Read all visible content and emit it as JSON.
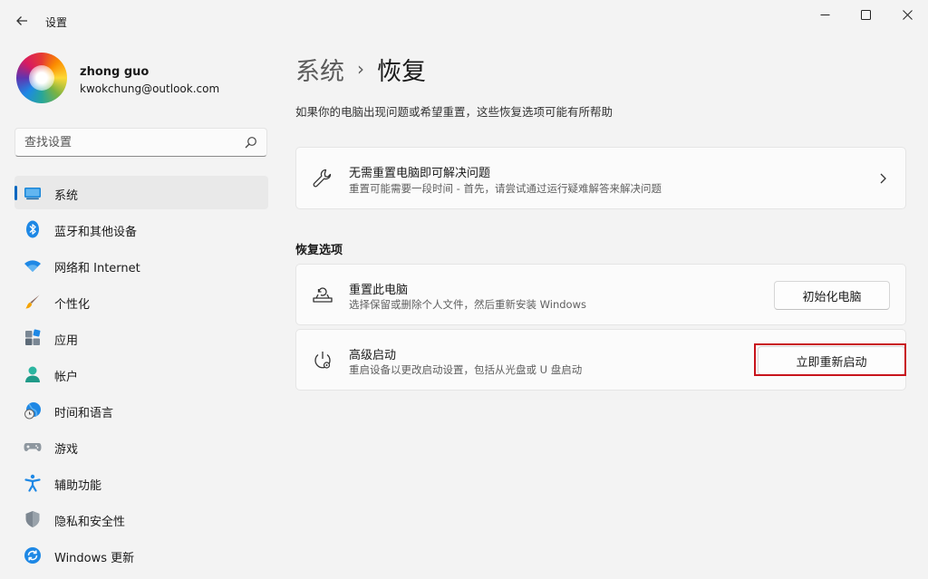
{
  "window": {
    "app_title": "设置"
  },
  "profile": {
    "name": "zhong guo",
    "email": "kwokchung@outlook.com"
  },
  "search": {
    "placeholder": "查找设置"
  },
  "sidebar": {
    "items": [
      {
        "label": "系统",
        "icon": "system-icon",
        "active": true
      },
      {
        "label": "蓝牙和其他设备",
        "icon": "bluetooth-icon"
      },
      {
        "label": "网络和 Internet",
        "icon": "wifi-icon"
      },
      {
        "label": "个性化",
        "icon": "brush-icon"
      },
      {
        "label": "应用",
        "icon": "apps-icon"
      },
      {
        "label": "帐户",
        "icon": "account-icon"
      },
      {
        "label": "时间和语言",
        "icon": "globe-clock-icon"
      },
      {
        "label": "游戏",
        "icon": "gamepad-icon"
      },
      {
        "label": "辅助功能",
        "icon": "accessibility-icon"
      },
      {
        "label": "隐私和安全性",
        "icon": "shield-icon"
      },
      {
        "label": "Windows 更新",
        "icon": "update-icon"
      }
    ]
  },
  "main": {
    "breadcrumb_parent": "系统",
    "breadcrumb_separator": "›",
    "breadcrumb_current": "恢复",
    "description": "如果你的电脑出现问题或希望重置，这些恢复选项可能有所帮助",
    "troubleshoot_card": {
      "title": "无需重置电脑即可解决问题",
      "subtitle": "重置可能需要一段时间 - 首先，请尝试通过运行疑难解答来解决问题"
    },
    "section_title": "恢复选项",
    "reset_card": {
      "title": "重置此电脑",
      "subtitle": "选择保留或删除个人文件，然后重新安装 Windows",
      "button": "初始化电脑"
    },
    "advanced_card": {
      "title": "高级启动",
      "subtitle": "重启设备以更改启动设置，包括从光盘或 U 盘启动",
      "button": "立即重新启动"
    }
  },
  "colors": {
    "accent": "#0067c0",
    "highlight": "#c8141c"
  }
}
